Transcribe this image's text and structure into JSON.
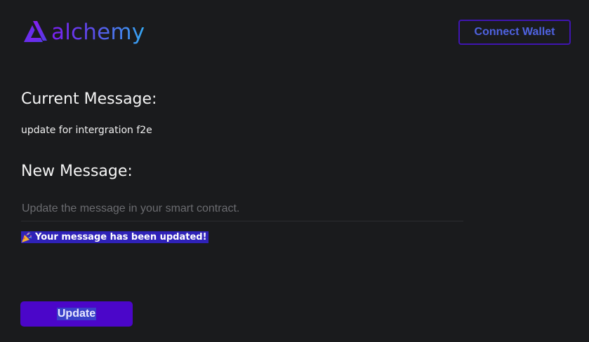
{
  "header": {
    "logo_text": "alchemy",
    "connect_label": "Connect Wallet"
  },
  "current": {
    "heading": "Current Message:",
    "text": "update for intergration f2e"
  },
  "new_message": {
    "heading": "New Message:",
    "placeholder": "Update the message in your smart contract.",
    "value": ""
  },
  "status": {
    "icon": "party-popper-icon",
    "text": "Your message has been updated!"
  },
  "actions": {
    "update_label": "Update"
  },
  "colors": {
    "background": "#1a1b1d",
    "brand_purple": "#4b06c9",
    "connect_border": "#3f15b0",
    "connect_text": "#4f62e0",
    "status_highlight": "#2f22b8"
  }
}
